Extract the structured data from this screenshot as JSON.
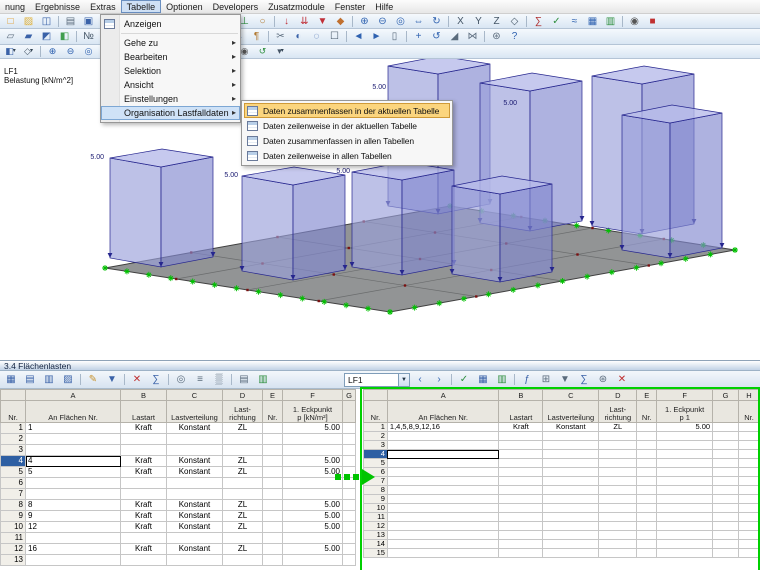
{
  "menubar": {
    "items": [
      {
        "label": "nung"
      },
      {
        "label": "Ergebnisse"
      },
      {
        "label": "Extras"
      },
      {
        "label": "Tabelle",
        "active": true
      },
      {
        "label": "Optionen"
      },
      {
        "label": "Developers"
      },
      {
        "label": "Zusatzmodule"
      },
      {
        "label": "Fenster"
      },
      {
        "label": "Hilfe"
      }
    ]
  },
  "toolbar_standard": {
    "icons": [
      {
        "n": "new-file-icon",
        "g": "□",
        "c": "#e09a28"
      },
      {
        "n": "open-icon",
        "g": "▨",
        "c": "#e0b23c"
      },
      {
        "n": "save-icon",
        "g": "◫",
        "c": "#3a62a8"
      },
      {
        "s": 1
      },
      {
        "n": "print-icon",
        "g": "▤",
        "c": "#5a6b7c"
      },
      {
        "n": "copy-icon",
        "g": "▣",
        "c": "#3a62a8"
      },
      {
        "s": 1
      },
      {
        "n": "undo-icon",
        "g": "↶",
        "c": "#2f62b0"
      },
      {
        "n": "redo-icon",
        "g": "↷",
        "c": "#2f62b0"
      },
      {
        "s": 1
      },
      {
        "n": "new-node-icon",
        "g": "●",
        "c": "#b03030"
      },
      {
        "n": "new-line-icon",
        "g": "╱",
        "c": "#2f62b0"
      },
      {
        "n": "new-surface-icon",
        "g": "▰",
        "c": "#3f9e4d"
      },
      {
        "n": "new-solid-icon",
        "g": "◼",
        "c": "#8a6ab0"
      },
      {
        "n": "new-opening-icon",
        "g": "▭",
        "c": "#777777"
      },
      {
        "n": "new-support-icon",
        "g": "⊥",
        "c": "#2f8f3f"
      },
      {
        "n": "new-hinge-icon",
        "g": "○",
        "c": "#b07830"
      },
      {
        "s": 1
      },
      {
        "n": "load-case-icon",
        "g": "↓",
        "c": "#c03038"
      },
      {
        "n": "member-load-icon",
        "g": "⇊",
        "c": "#c03038"
      },
      {
        "n": "surface-load-icon",
        "g": "▼",
        "c": "#c03038"
      },
      {
        "n": "free-load-icon",
        "g": "◆",
        "c": "#c07030"
      },
      {
        "s": 1
      },
      {
        "n": "zoom-in-icon",
        "g": "⊕",
        "c": "#2f62b0"
      },
      {
        "n": "zoom-out-icon",
        "g": "⊖",
        "c": "#2f62b0"
      },
      {
        "n": "zoom-all-icon",
        "g": "◎",
        "c": "#2f62b0"
      },
      {
        "n": "pan-icon",
        "g": "⇔",
        "c": "#2f62b0"
      },
      {
        "n": "rotate-view-icon",
        "g": "↻",
        "c": "#2f62b0"
      },
      {
        "s": 1
      },
      {
        "n": "view-x-icon",
        "g": "X",
        "c": "#445566"
      },
      {
        "n": "view-y-icon",
        "g": "Y",
        "c": "#445566"
      },
      {
        "n": "view-z-icon",
        "g": "Z",
        "c": "#445566"
      },
      {
        "n": "view-isometric-icon",
        "g": "◇",
        "c": "#445566"
      },
      {
        "s": 1
      },
      {
        "n": "calculate-icon",
        "g": "∑",
        "c": "#b03030"
      },
      {
        "n": "check-model-icon",
        "g": "✓",
        "c": "#2f8f3f"
      },
      {
        "n": "results-icon",
        "g": "≈",
        "c": "#2f62b0"
      },
      {
        "n": "tables-icon",
        "g": "▦",
        "c": "#2f62b0"
      },
      {
        "n": "excel-icon",
        "g": "▥",
        "c": "#2f8f3f"
      },
      {
        "s": 1
      },
      {
        "n": "camera-icon",
        "g": "◉",
        "c": "#555555"
      },
      {
        "n": "stop-icon",
        "g": "■",
        "c": "#c03030"
      }
    ]
  },
  "toolbar_display": {
    "icons": [
      {
        "n": "wireframe-icon",
        "g": "▱",
        "c": "#5a6b7c"
      },
      {
        "n": "shaded-icon",
        "g": "▰",
        "c": "#3a62a8"
      },
      {
        "n": "transparent-icon",
        "g": "◩",
        "c": "#3a62a8"
      },
      {
        "n": "render-icon",
        "g": "◧",
        "c": "#3f9e4d"
      },
      {
        "s": 1
      },
      {
        "n": "show-numbering-icon",
        "g": "№",
        "c": "#445566"
      },
      {
        "n": "show-grid-icon",
        "g": "⊞",
        "c": "#5a6b7c"
      },
      {
        "n": "snap-icon",
        "g": "◎",
        "c": "#b07830"
      },
      {
        "n": "guidelines-icon",
        "g": "∥",
        "c": "#5a6b7c"
      },
      {
        "n": "axes-icon",
        "g": "∠",
        "c": "#b03030"
      },
      {
        "s": 1
      },
      {
        "n": "show-supports-icon",
        "g": "⊥",
        "c": "#2f8f3f"
      },
      {
        "n": "show-loads-icon",
        "g": "↓",
        "c": "#c03038"
      },
      {
        "n": "show-values-icon",
        "g": "#",
        "c": "#445566"
      },
      {
        "n": "dimensions-icon",
        "g": "↔",
        "c": "#2f62b0"
      },
      {
        "n": "comments-icon",
        "g": "¶",
        "c": "#b07830"
      },
      {
        "s": 1
      },
      {
        "n": "section-icon",
        "g": "✂",
        "c": "#5a6b7c"
      },
      {
        "n": "visibility-icon",
        "g": "◐",
        "c": "#3a62a8"
      },
      {
        "n": "isolate-icon",
        "g": "◌",
        "c": "#3a62a8"
      },
      {
        "n": "select-icon",
        "g": "☐",
        "c": "#445566"
      },
      {
        "s": 1
      },
      {
        "n": "previous-view-icon",
        "g": "◄",
        "c": "#2f62b0"
      },
      {
        "n": "next-view-icon",
        "g": "►",
        "c": "#2f62b0"
      },
      {
        "n": "new-window-icon",
        "g": "▯",
        "c": "#5a6b7c"
      },
      {
        "s": 1
      },
      {
        "n": "move-model-icon",
        "g": "+",
        "c": "#2f62b0"
      },
      {
        "n": "rotate-model-icon",
        "g": "↺",
        "c": "#2f62b0"
      },
      {
        "n": "scale-icon",
        "g": "◢",
        "c": "#5a6b7c"
      },
      {
        "n": "mirror-icon",
        "g": "⋈",
        "c": "#5a6b7c"
      },
      {
        "s": 1
      },
      {
        "n": "settings-icon",
        "g": "⊛",
        "c": "#5a6b7c"
      },
      {
        "n": "help-icon",
        "g": "?",
        "c": "#2f62b0"
      }
    ]
  },
  "toolbar_view": {
    "icons": [
      {
        "n": "display-properties-icon",
        "g": "◧",
        "c": "#3a62a8",
        "d": 1
      },
      {
        "n": "view-mode-icon",
        "g": "◇",
        "c": "#445566",
        "d": 1
      },
      {
        "s": 1
      },
      {
        "n": "zoom-in-small-icon",
        "g": "⊕",
        "c": "#2f62b0"
      },
      {
        "n": "zoom-out-small-icon",
        "g": "⊖",
        "c": "#2f62b0"
      },
      {
        "n": "zoom-window-small-icon",
        "g": "◎",
        "c": "#2f62b0"
      },
      {
        "n": "pan-small-icon",
        "g": "⇔",
        "c": "#2f62b0"
      },
      {
        "n": "rotate-small-icon",
        "g": "↻",
        "c": "#2f62b0"
      },
      {
        "s": 1
      },
      {
        "n": "full-model-icon",
        "g": "▦",
        "c": "#3a62a8"
      },
      {
        "n": "partial-view-icon",
        "g": "▧",
        "c": "#3a62a8"
      },
      {
        "n": "clipping-icon",
        "g": "◪",
        "c": "#5a6b7c"
      },
      {
        "s": 1
      },
      {
        "n": "background-icon",
        "g": "▒",
        "c": "#5a6b7c"
      },
      {
        "n": "light-icon",
        "g": "☀",
        "c": "#e0a028"
      },
      {
        "n": "camera-view-icon",
        "g": "◉",
        "c": "#555555"
      },
      {
        "n": "refresh-icon",
        "g": "↺",
        "c": "#2f8f3f"
      },
      {
        "n": "more-views-icon",
        "g": "▾",
        "c": "#445566",
        "d": 1
      }
    ]
  },
  "viewport": {
    "lf": "LF1",
    "sub": "Belastung [kN/m^2]",
    "load_value": "5.00"
  },
  "tabelle_menu": {
    "items": [
      {
        "label": "Anzeigen",
        "icon": true
      },
      {
        "sep": true
      },
      {
        "label": "Gehe zu",
        "arrow": true
      },
      {
        "label": "Bearbeiten",
        "arrow": true
      },
      {
        "label": "Selektion",
        "arrow": true
      },
      {
        "label": "Ansicht",
        "arrow": true
      },
      {
        "label": "Einstellungen",
        "arrow": true
      },
      {
        "label": "Organisation Lastfalldaten",
        "arrow": true,
        "highlighted": true
      }
    ]
  },
  "organisation_submenu": {
    "items": [
      {
        "label": "Daten zusammenfassen in der aktuellen Tabelle",
        "selected": true
      },
      {
        "label": "Daten zeilenweise in der aktuellen Tabelle"
      },
      {
        "label": "Daten zusammenfassen in allen Tabellen"
      },
      {
        "label": "Daten zeilenweise in allen Tabellen"
      }
    ]
  },
  "panel": {
    "title": "3.4 Flächenlasten",
    "lf_combo": "LF1",
    "toolbar_left": [
      {
        "n": "copy-table-icon",
        "g": "▦",
        "c": "#3a62a8"
      },
      {
        "n": "insert-row-icon",
        "g": "▤",
        "c": "#3a62a8"
      },
      {
        "n": "delete-row-icon",
        "g": "▥",
        "c": "#3a62a8"
      },
      {
        "n": "table-settings-icon",
        "g": "▨",
        "c": "#3a62a8"
      },
      {
        "s": 1
      },
      {
        "n": "edit-cell-icon",
        "g": "✎",
        "c": "#c8922e"
      },
      {
        "n": "fill-down-icon",
        "g": "▼",
        "c": "#3a62a8"
      },
      {
        "s": 1
      },
      {
        "n": "delete-contents-icon",
        "g": "✕",
        "c": "#c03030"
      },
      {
        "n": "sum-icon",
        "g": "∑",
        "c": "#3a62a8"
      },
      {
        "s": 1
      },
      {
        "n": "search-icon",
        "g": "◎",
        "c": "#5a6b7c"
      },
      {
        "n": "sort-icon",
        "g": "≡",
        "c": "#5a6b7c"
      },
      {
        "n": "color-scale-icon",
        "g": "▒",
        "c": "#5a6b7c"
      },
      {
        "s": 1
      },
      {
        "n": "print-table-icon",
        "g": "▤",
        "c": "#5a6b7c"
      },
      {
        "n": "export-excel-icon",
        "g": "▥",
        "c": "#2f8f3f"
      }
    ],
    "toolbar_right": [
      {
        "n": "previous-loadcase-icon",
        "g": "‹",
        "c": "#2f62b0"
      },
      {
        "n": "next-loadcase-icon",
        "g": "›",
        "c": "#2f62b0"
      },
      {
        "s": 1
      },
      {
        "n": "apply-icon",
        "g": "✓",
        "c": "#2f8f3f"
      },
      {
        "n": "import-table-icon",
        "g": "▦",
        "c": "#3a62a8"
      },
      {
        "n": "export-table-icon",
        "g": "▥",
        "c": "#2f8f3f"
      },
      {
        "s": 1
      },
      {
        "n": "function-icon",
        "g": "ƒ",
        "c": "#3a62a8"
      },
      {
        "n": "calculator-icon",
        "g": "⊞",
        "c": "#5a6b7c"
      },
      {
        "n": "filter-icon",
        "g": "▼",
        "c": "#5a6b7c"
      },
      {
        "n": "sum-values-icon",
        "g": "∑",
        "c": "#3a62a8"
      },
      {
        "n": "table-options-icon",
        "g": "⊛",
        "c": "#5a6b7c"
      },
      {
        "n": "close-table-icon",
        "g": "✕",
        "c": "#c03030"
      }
    ]
  },
  "left_table": {
    "letters": [
      "",
      "A",
      "B",
      "C",
      "D",
      "E",
      "F",
      "G"
    ],
    "desc": [
      [
        "Nr."
      ],
      [
        "An Flächen Nr."
      ],
      [
        "Lastart"
      ],
      [
        "Lastverteilung"
      ],
      [
        "Last-",
        "richtung"
      ],
      [
        "Nr."
      ],
      [
        "1. Eckpunkt",
        "p [kN/m²]"
      ],
      [
        ""
      ]
    ],
    "widths": [
      25,
      95,
      46,
      56,
      40,
      20,
      60,
      13
    ],
    "aligns": [
      "right",
      "left",
      "center",
      "center",
      "center",
      "center",
      "right",
      "left"
    ],
    "rows": [
      {
        "cells": [
          "1",
          "1",
          "Kraft",
          "Konstant",
          "ZL",
          "",
          "5.00",
          ""
        ]
      },
      {
        "cells": [
          "2",
          "",
          "",
          "",
          "",
          "",
          "",
          ""
        ]
      },
      {
        "cells": [
          "3",
          "",
          "",
          "",
          "",
          "",
          "",
          ""
        ]
      },
      {
        "cells": [
          "4",
          "4",
          "Kraft",
          "Konstant",
          "ZL",
          "",
          "5.00",
          ""
        ],
        "selected": true,
        "focus_col": 1
      },
      {
        "cells": [
          "5",
          "5",
          "Kraft",
          "Konstant",
          "ZL",
          "",
          "5.00",
          ""
        ]
      },
      {
        "cells": [
          "6",
          "",
          "",
          "",
          "",
          "",
          "",
          ""
        ]
      },
      {
        "cells": [
          "7",
          "",
          "",
          "",
          "",
          "",
          "",
          ""
        ]
      },
      {
        "cells": [
          "8",
          "8",
          "Kraft",
          "Konstant",
          "ZL",
          "",
          "5.00",
          ""
        ]
      },
      {
        "cells": [
          "9",
          "9",
          "Kraft",
          "Konstant",
          "ZL",
          "",
          "5.00",
          ""
        ]
      },
      {
        "cells": [
          "10",
          "12",
          "Kraft",
          "Konstant",
          "ZL",
          "",
          "5.00",
          ""
        ]
      },
      {
        "cells": [
          "11",
          "",
          "",
          "",
          "",
          "",
          "",
          ""
        ]
      },
      {
        "cells": [
          "12",
          "16",
          "Kraft",
          "Konstant",
          "ZL",
          "",
          "5.00",
          ""
        ]
      },
      {
        "cells": [
          "13",
          "",
          "",
          "",
          "",
          "",
          "",
          ""
        ]
      }
    ]
  },
  "right_table": {
    "letters": [
      "",
      "A",
      "B",
      "C",
      "D",
      "E",
      "F",
      "G",
      "H"
    ],
    "desc": [
      [
        "Nr."
      ],
      [
        "An Flächen Nr."
      ],
      [
        "Lastart"
      ],
      [
        "Lastverteilung"
      ],
      [
        "Last-",
        "richtung"
      ],
      [
        "Nr."
      ],
      [
        "1. Eckpunkt",
        "p 1"
      ],
      [
        ""
      ],
      [
        "Nr."
      ]
    ],
    "widths": [
      24,
      112,
      44,
      56,
      38,
      20,
      56,
      26,
      21
    ],
    "aligns": [
      "right",
      "left",
      "center",
      "center",
      "center",
      "center",
      "right",
      "left",
      "left"
    ],
    "rows": [
      {
        "cells": [
          "1",
          "1,4,5,8,9,12,16",
          "Kraft",
          "Konstant",
          "ZL",
          "",
          "5.00",
          "",
          ""
        ]
      },
      {
        "cells": [
          "2",
          "",
          "",
          "",
          "",
          "",
          "",
          "",
          ""
        ]
      },
      {
        "cells": [
          "3",
          "",
          "",
          "",
          "",
          "",
          "",
          "",
          ""
        ]
      },
      {
        "cells": [
          "4",
          "",
          "",
          "",
          "",
          "",
          "",
          "",
          ""
        ],
        "selected": true,
        "focus_col": 1
      },
      {
        "cells": [
          "5",
          "",
          "",
          "",
          "",
          "",
          "",
          "",
          ""
        ]
      },
      {
        "cells": [
          "6",
          "",
          "",
          "",
          "",
          "",
          "",
          "",
          ""
        ]
      },
      {
        "cells": [
          "7",
          "",
          "",
          "",
          "",
          "",
          "",
          "",
          ""
        ]
      },
      {
        "cells": [
          "8",
          "",
          "",
          "",
          "",
          "",
          "",
          "",
          ""
        ]
      },
      {
        "cells": [
          "9",
          "",
          "",
          "",
          "",
          "",
          "",
          "",
          ""
        ]
      },
      {
        "cells": [
          "10",
          "",
          "",
          "",
          "",
          "",
          "",
          "",
          ""
        ]
      },
      {
        "cells": [
          "11",
          "",
          "",
          "",
          "",
          "",
          "",
          "",
          ""
        ]
      },
      {
        "cells": [
          "12",
          "",
          "",
          "",
          "",
          "",
          "",
          "",
          ""
        ]
      },
      {
        "cells": [
          "13",
          "",
          "",
          "",
          "",
          "",
          "",
          "",
          ""
        ]
      },
      {
        "cells": [
          "14",
          "",
          "",
          "",
          "",
          "",
          "",
          "",
          ""
        ]
      },
      {
        "cells": [
          "15",
          "",
          "",
          "",
          "",
          "",
          "",
          "",
          ""
        ]
      }
    ]
  }
}
